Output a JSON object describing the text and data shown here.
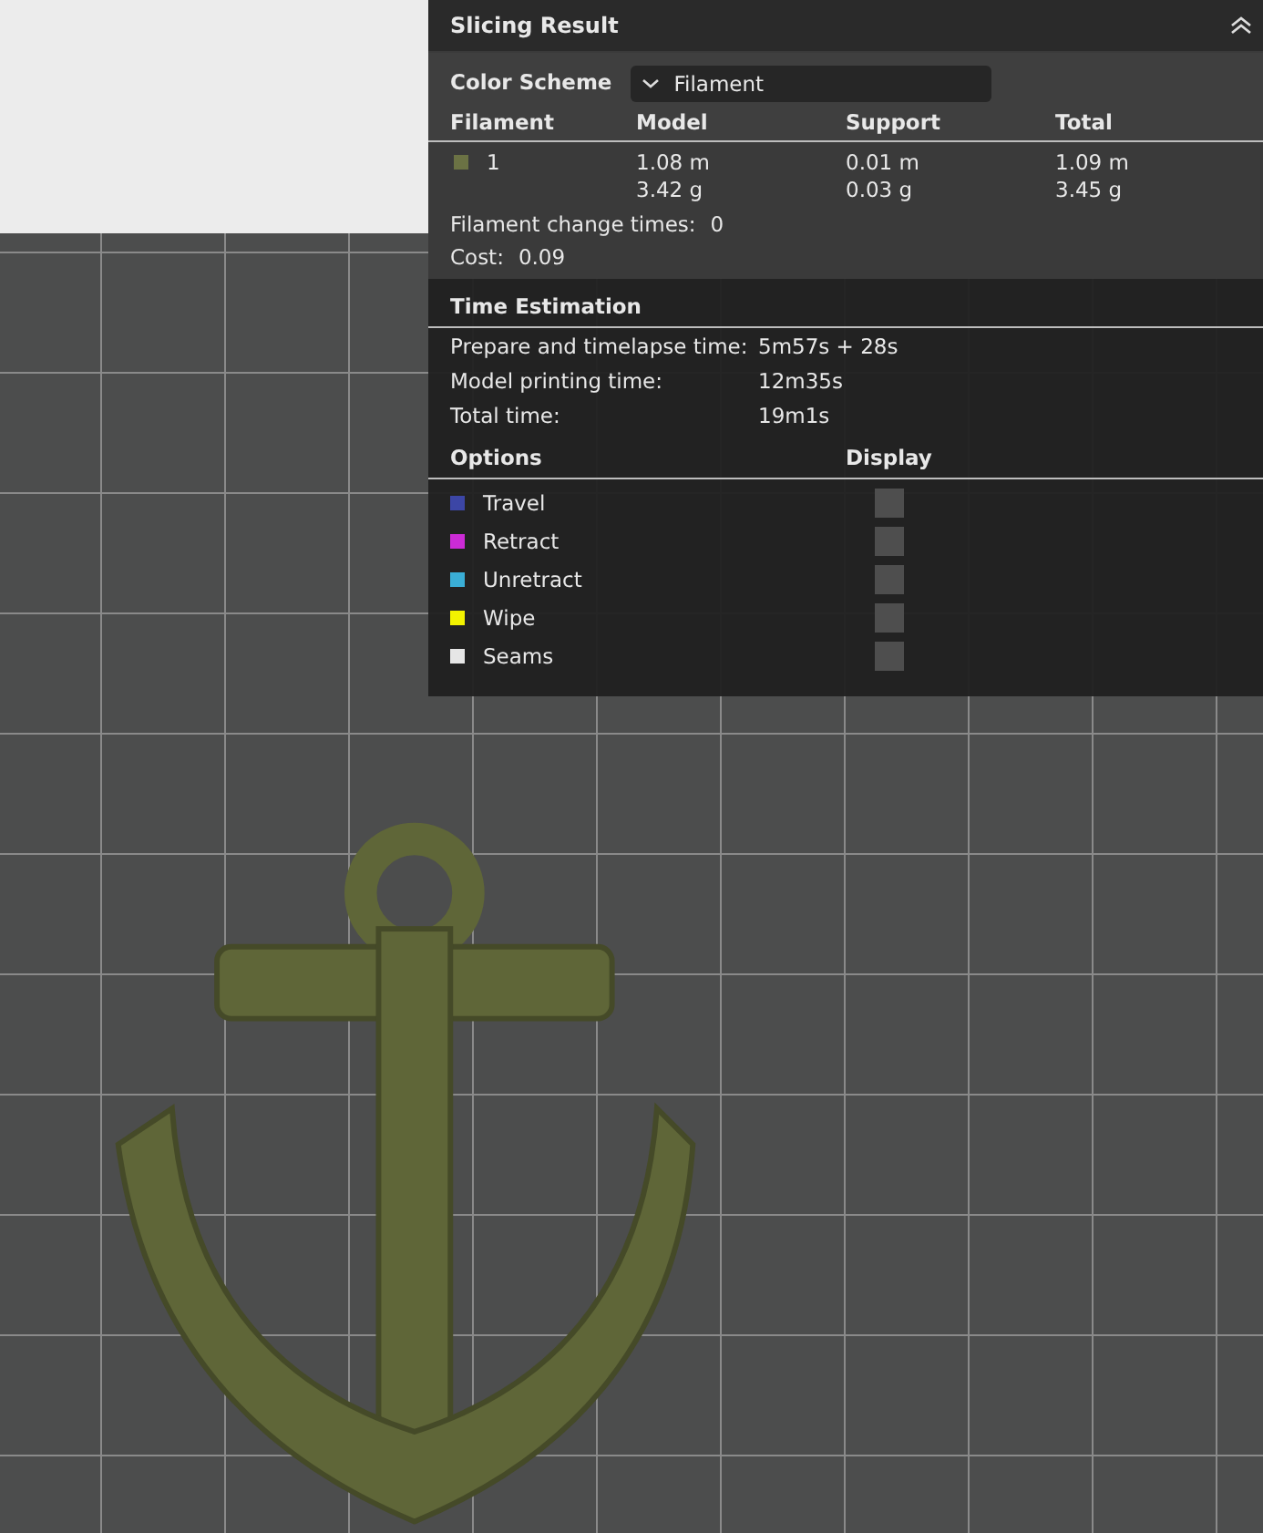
{
  "panel": {
    "title": "Slicing Result",
    "expanded": true
  },
  "color_scheme": {
    "label": "Color Scheme",
    "value": "Filament"
  },
  "filament_table": {
    "columns": [
      "Filament",
      "Model",
      "Support",
      "Total"
    ],
    "rows": [
      {
        "filament": "1",
        "color": "#6b7244",
        "model": [
          "1.08 m",
          "3.42 g"
        ],
        "support": [
          "0.01 m",
          "0.03 g"
        ],
        "total": [
          "1.09 m",
          "3.45 g"
        ]
      }
    ]
  },
  "summary": [
    {
      "label": "Filament change times:",
      "value": "0"
    },
    {
      "label": "Cost:",
      "value": "0.09"
    }
  ],
  "time_estimation": {
    "title": "Time Estimation",
    "rows": [
      {
        "label": "Prepare and timelapse time:",
        "value": "5m57s + 28s"
      },
      {
        "label": "Model printing time:",
        "value": "12m35s"
      },
      {
        "label": "Total time:",
        "value": "19m1s"
      }
    ]
  },
  "options": {
    "columns": [
      "Options",
      "Display"
    ],
    "items": [
      {
        "label": "Travel",
        "color": "#3c46a6",
        "checked": false
      },
      {
        "label": "Retract",
        "color": "#cc2bd6",
        "checked": false
      },
      {
        "label": "Unretract",
        "color": "#3aaed6",
        "checked": false
      },
      {
        "label": "Wipe",
        "color": "#f2f200",
        "checked": false
      },
      {
        "label": "Seams",
        "color": "#e6e6e6",
        "checked": false
      }
    ]
  }
}
